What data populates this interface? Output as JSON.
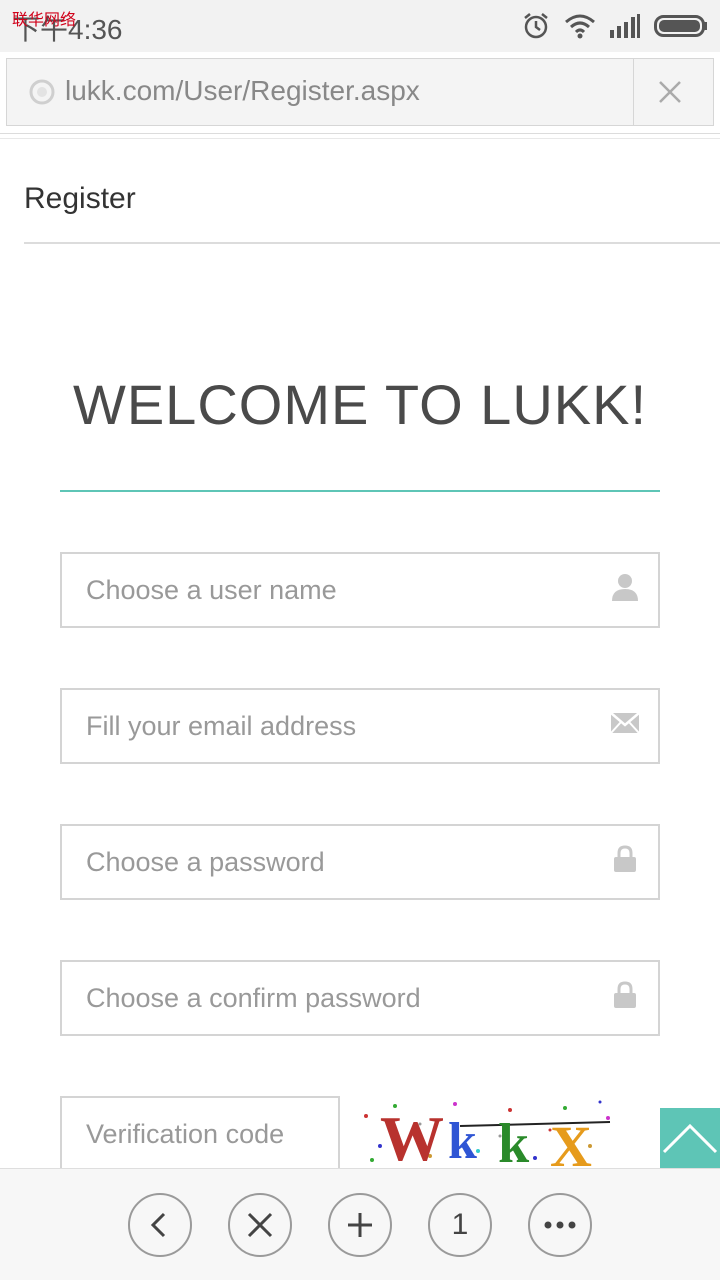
{
  "status_bar": {
    "time": "下午4:36",
    "watermark": "联华网络",
    "icons": [
      "alarm-icon",
      "wifi-icon",
      "signal-icon",
      "battery-icon"
    ]
  },
  "address_bar": {
    "url": "lukk.com/User/Register.aspx",
    "icons": [
      "globe-icon",
      "close-icon"
    ]
  },
  "page": {
    "header": "Register",
    "welcome": "WELCOME TO LUKK!"
  },
  "form": {
    "username_placeholder": "Choose a user name",
    "email_placeholder": "Fill your email address",
    "password_placeholder": "Choose a password",
    "confirm_placeholder": "Choose a confirm password",
    "verification_placeholder": "Verification code",
    "captcha_text": "WkkX",
    "icons": [
      "user-icon",
      "mail-icon",
      "lock-icon",
      "lock-icon"
    ]
  },
  "bottom_nav": {
    "tab_count": "1",
    "icons": [
      "back-icon",
      "close-icon",
      "add-icon",
      "tabs-icon",
      "more-icon"
    ]
  },
  "colors": {
    "accent": "#5ec5b6",
    "field_border": "#d4d4d4",
    "placeholder": "#999999",
    "heading": "#4a4a4a"
  }
}
